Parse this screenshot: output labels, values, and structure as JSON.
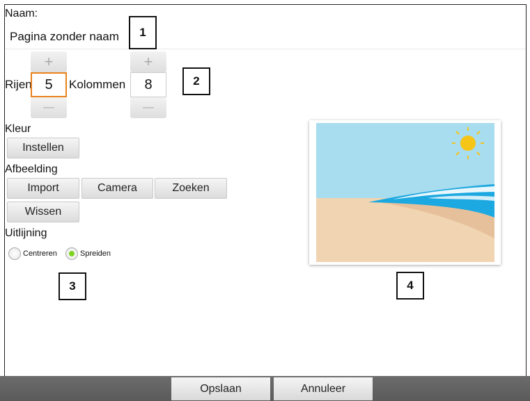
{
  "form": {
    "name_label": "Naam:",
    "name_value": "Pagina zonder naam",
    "rows_label": "Rijen",
    "rows_value": "5",
    "cols_label": "Kolommen",
    "cols_value": "8",
    "plus_symbol": "+",
    "minus_symbol": "—"
  },
  "color": {
    "label": "Kleur",
    "set_button": "Instellen"
  },
  "image": {
    "label": "Afbeelding",
    "import_button": "Import",
    "camera_button": "Camera",
    "search_button": "Zoeken",
    "clear_button": "Wissen"
  },
  "alignment": {
    "label": "Uitlijning",
    "options": [
      {
        "label": "Centreren",
        "selected": false
      },
      {
        "label": "Spreiden",
        "selected": true
      }
    ]
  },
  "callouts": [
    "1",
    "2",
    "3",
    "4"
  ],
  "footer": {
    "save_button": "Opslaan",
    "cancel_button": "Annuleer"
  },
  "colors": {
    "stepper_focus": "#e8821b",
    "radio_selected": "#7ed321",
    "sky": "#a8dcef",
    "sand": "#f1d4b2",
    "sea": "#1ca8e0",
    "sun": "#f5c518",
    "bottom_bar": "#646464"
  }
}
